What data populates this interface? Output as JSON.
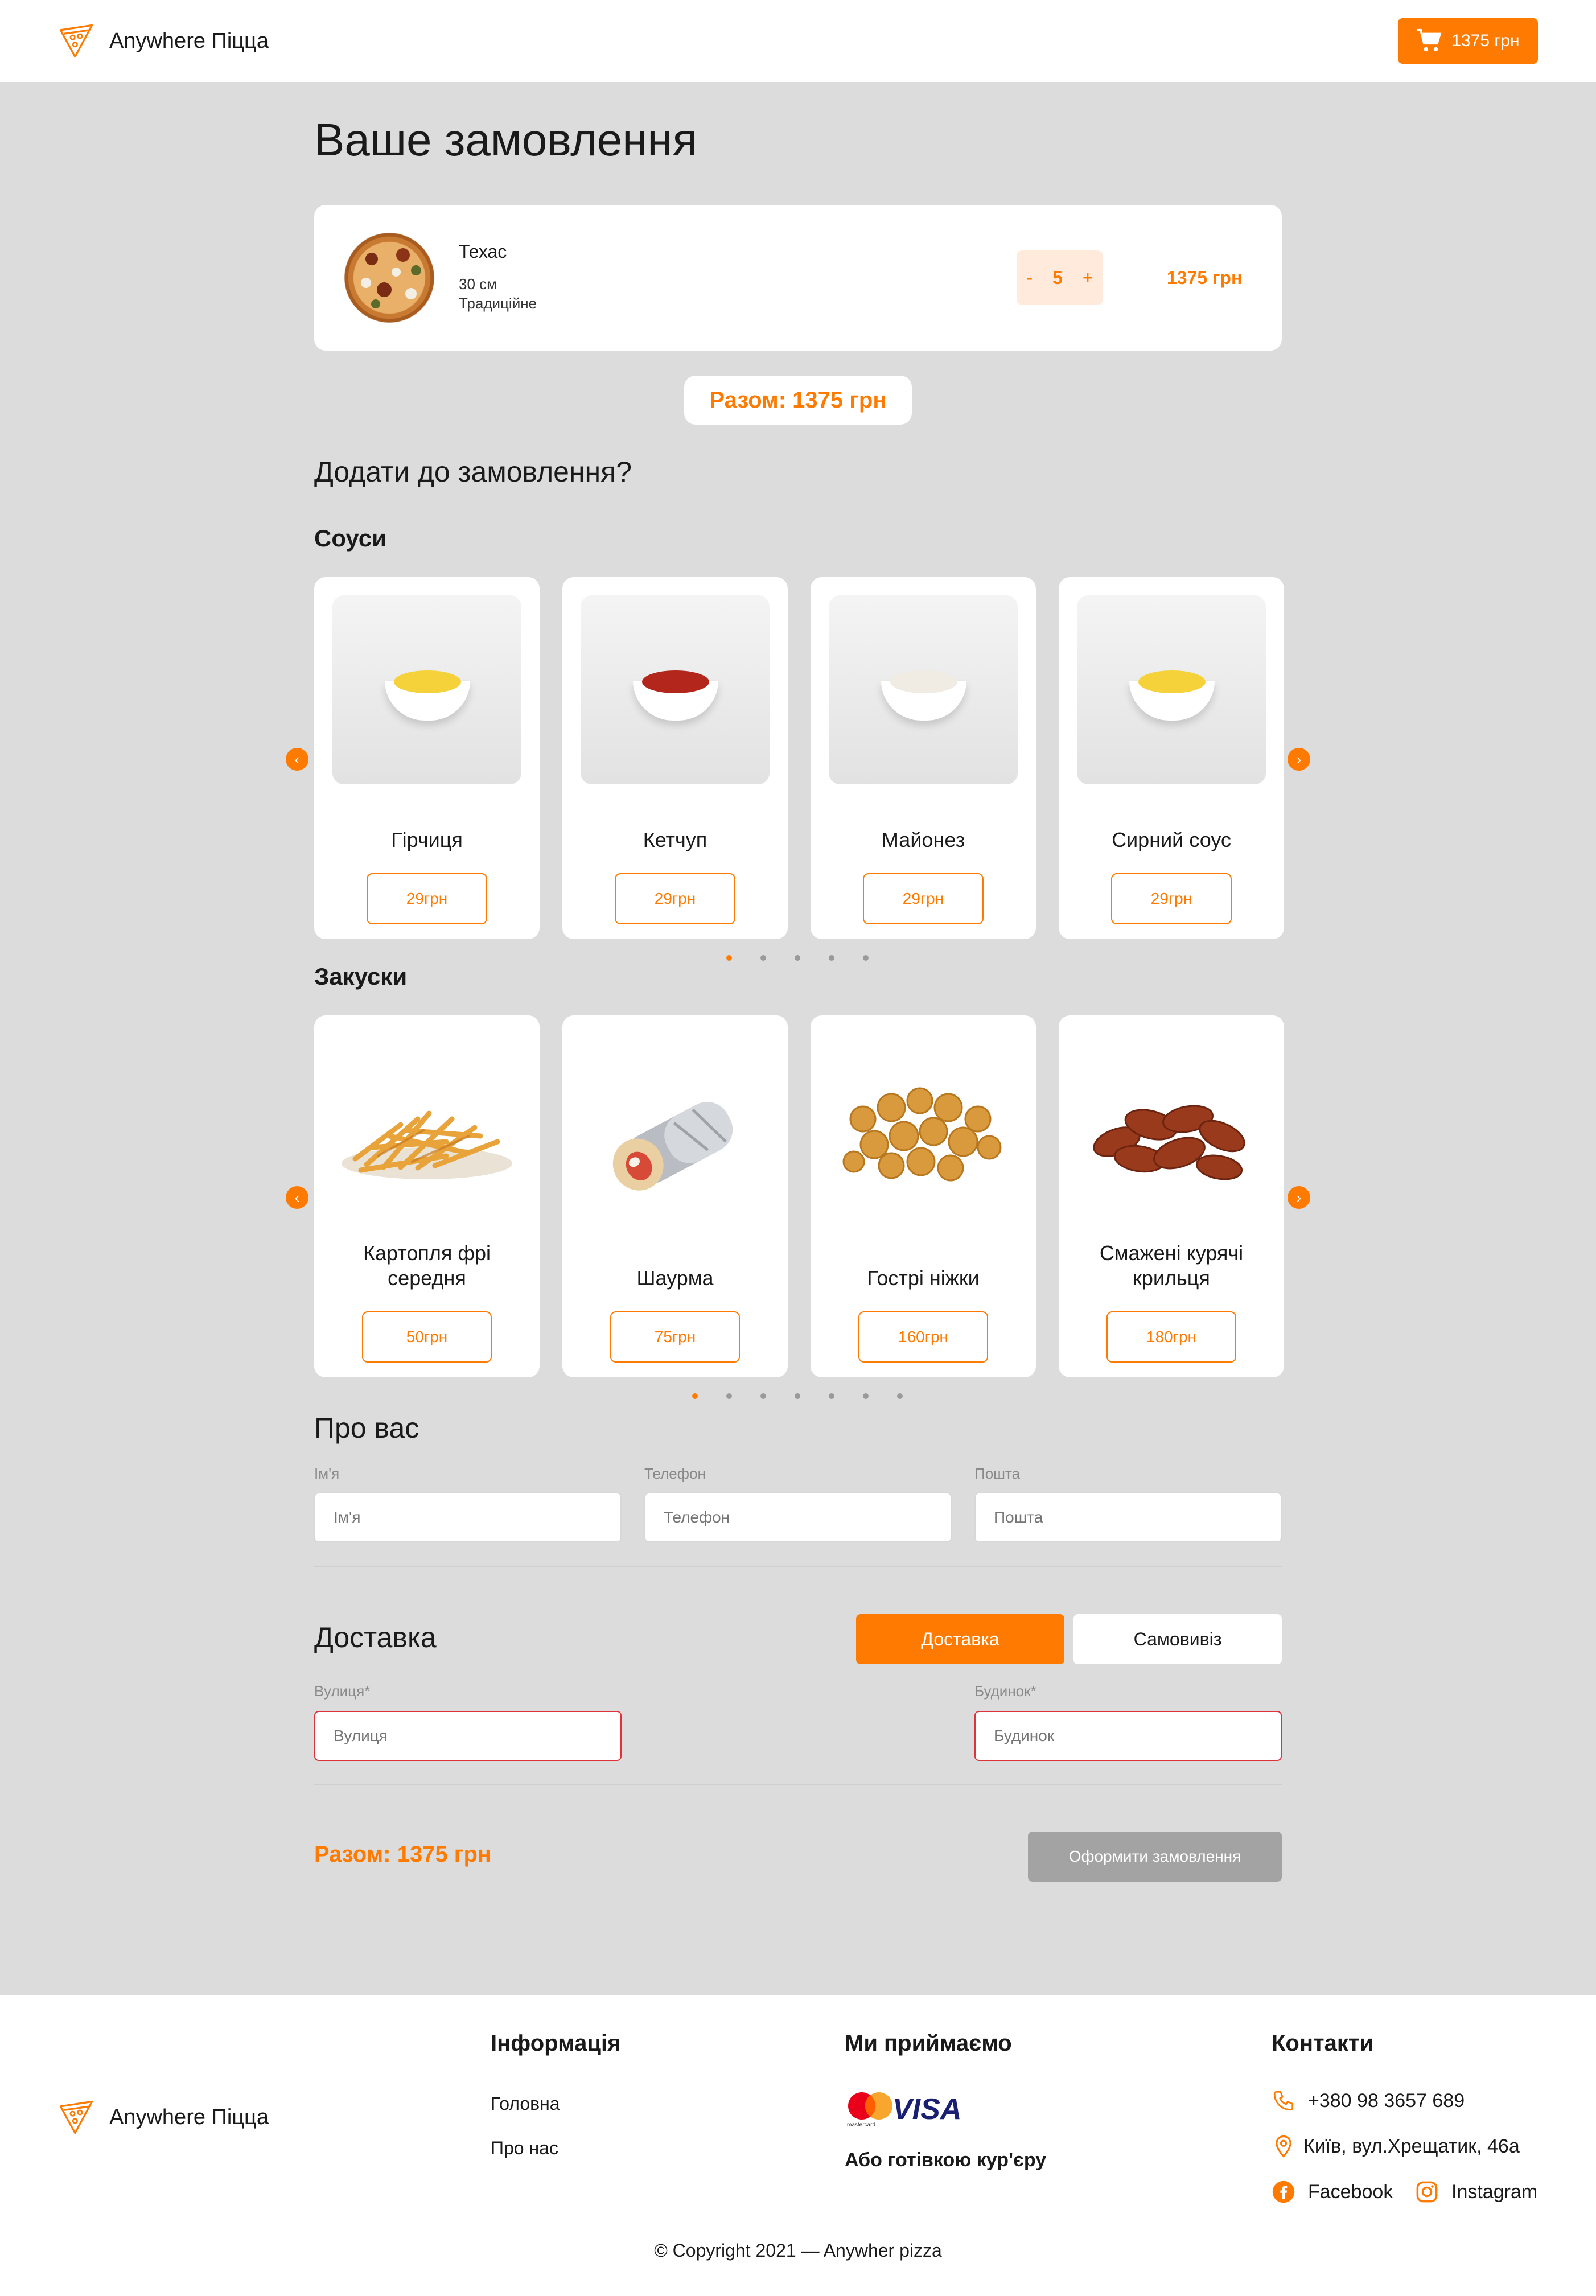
{
  "header": {
    "brand": "Anywhere Піцца",
    "cart_total": "1375 грн"
  },
  "order": {
    "title": "Ваше замовлення",
    "item": {
      "name": "Техас",
      "size": "30 см",
      "dough": "Традиційне",
      "qty_minus": "-",
      "qty": "5",
      "qty_plus": "+",
      "price": "1375 грн"
    },
    "total": "Разом: 1375 грн"
  },
  "addons": {
    "title": "Додати до замовлення?",
    "sauces": {
      "title": "Соуси",
      "items": [
        {
          "name": "Гірчиця",
          "price": "29грн",
          "color": "#f5d23a"
        },
        {
          "name": "Кетчуп",
          "price": "29грн",
          "color": "#b2261b"
        },
        {
          "name": "Майонез",
          "price": "29грн",
          "color": "#f1ece3"
        },
        {
          "name": "Сирний соус",
          "price": "29грн",
          "color": "#f5d23a"
        }
      ]
    },
    "snacks": {
      "title": "Закуски",
      "items": [
        {
          "name_line1": "Картопля фрі",
          "name_line2": "середня",
          "price": "50грн"
        },
        {
          "name_line1": "",
          "name_line2": "Шаурма",
          "price": "75грн"
        },
        {
          "name_line1": "",
          "name_line2": "Гострі ніжки",
          "price": "160грн"
        },
        {
          "name_line1": "Смажені курячі",
          "name_line2": "крильця",
          "price": "180грн"
        }
      ]
    }
  },
  "about": {
    "title": "Про вас",
    "name_label": "Ім'я",
    "name_placeholder": "Ім'я",
    "phone_label": "Телефон",
    "phone_placeholder": "Телефон",
    "email_label": "Пошта",
    "email_placeholder": "Пошта"
  },
  "delivery": {
    "title": "Доставка",
    "tab_delivery": "Доставка",
    "tab_pickup": "Самовивіз",
    "street_label": "Вулиця*",
    "street_placeholder": "Вулиця",
    "house_label": "Будинок*",
    "house_placeholder": "Будинок"
  },
  "checkout": {
    "total": "Разом: 1375 грн",
    "submit": "Оформити замовлення"
  },
  "footer": {
    "brand": "Anywhere Піцца",
    "info_title": "Інформація",
    "links": [
      "Головна",
      "Про нас"
    ],
    "payments_title": "Ми приймаємо",
    "mastercard_text": "mastercard",
    "visa_text": "VISA",
    "cash_text": "Або готівкою кур'єру",
    "contacts_title": "Контакти",
    "phone": "+380 98 3657 689",
    "address": "Київ, вул.Хрещатик, 46а",
    "facebook": "Facebook",
    "instagram": "Instagram",
    "copyright": "© Copyright 2021 — Anywher pizza"
  },
  "colors": {
    "accent": "#ff7a00",
    "page_bg": "#dcdcdc",
    "error": "#e0323a",
    "disabled": "#a3a3a3"
  }
}
